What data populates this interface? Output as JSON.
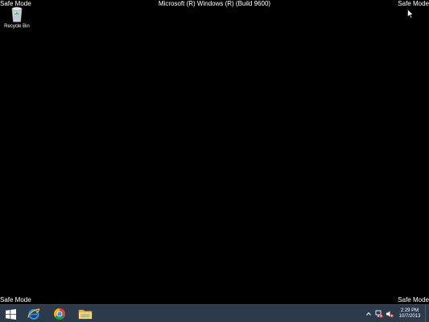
{
  "overlay": {
    "safe_mode": "Safe Mode",
    "build": "Microsoft (R) Windows (R) (Build 9600)"
  },
  "desktop": {
    "icons": [
      {
        "label": "Recycle Bin",
        "icon": "recycle-bin-icon"
      }
    ]
  },
  "taskbar": {
    "pinned": [
      {
        "name": "start",
        "icon": "windows-logo-icon"
      },
      {
        "name": "internet-explorer",
        "icon": "internet-explorer-icon"
      },
      {
        "name": "chrome",
        "icon": "chrome-icon"
      },
      {
        "name": "file-explorer",
        "icon": "file-explorer-icon"
      }
    ],
    "tray": {
      "icons": [
        "show-hidden-icons-chevron",
        "network-icon",
        "volume-muted-icon"
      ],
      "time": "2:29 PM",
      "date": "10/7/2013"
    },
    "colors": {
      "background": "#2c3a4c",
      "desktop": "#000000"
    }
  }
}
